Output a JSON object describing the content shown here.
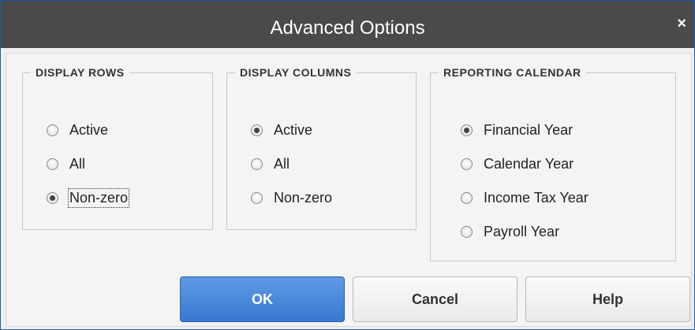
{
  "dialog": {
    "title": "Advanced Options",
    "close_glyph": "×"
  },
  "groups": {
    "display_rows": {
      "legend": "DISPLAY ROWS",
      "options": [
        "Active",
        "All",
        "Non-zero"
      ],
      "selected": "Non-zero"
    },
    "display_columns": {
      "legend": "DISPLAY COLUMNS",
      "options": [
        "Active",
        "All",
        "Non-zero"
      ],
      "selected": "Active"
    },
    "reporting_calendar": {
      "legend": "REPORTING CALENDAR",
      "options": [
        "Financial Year",
        "Calendar Year",
        "Income Tax Year",
        "Payroll Year"
      ],
      "selected": "Financial Year"
    }
  },
  "buttons": {
    "ok": "OK",
    "cancel": "Cancel",
    "help": "Help"
  },
  "colors": {
    "title_bar": "#4a4a4a",
    "primary_button": "#3a78d0",
    "window_border": "#1f56b5"
  }
}
